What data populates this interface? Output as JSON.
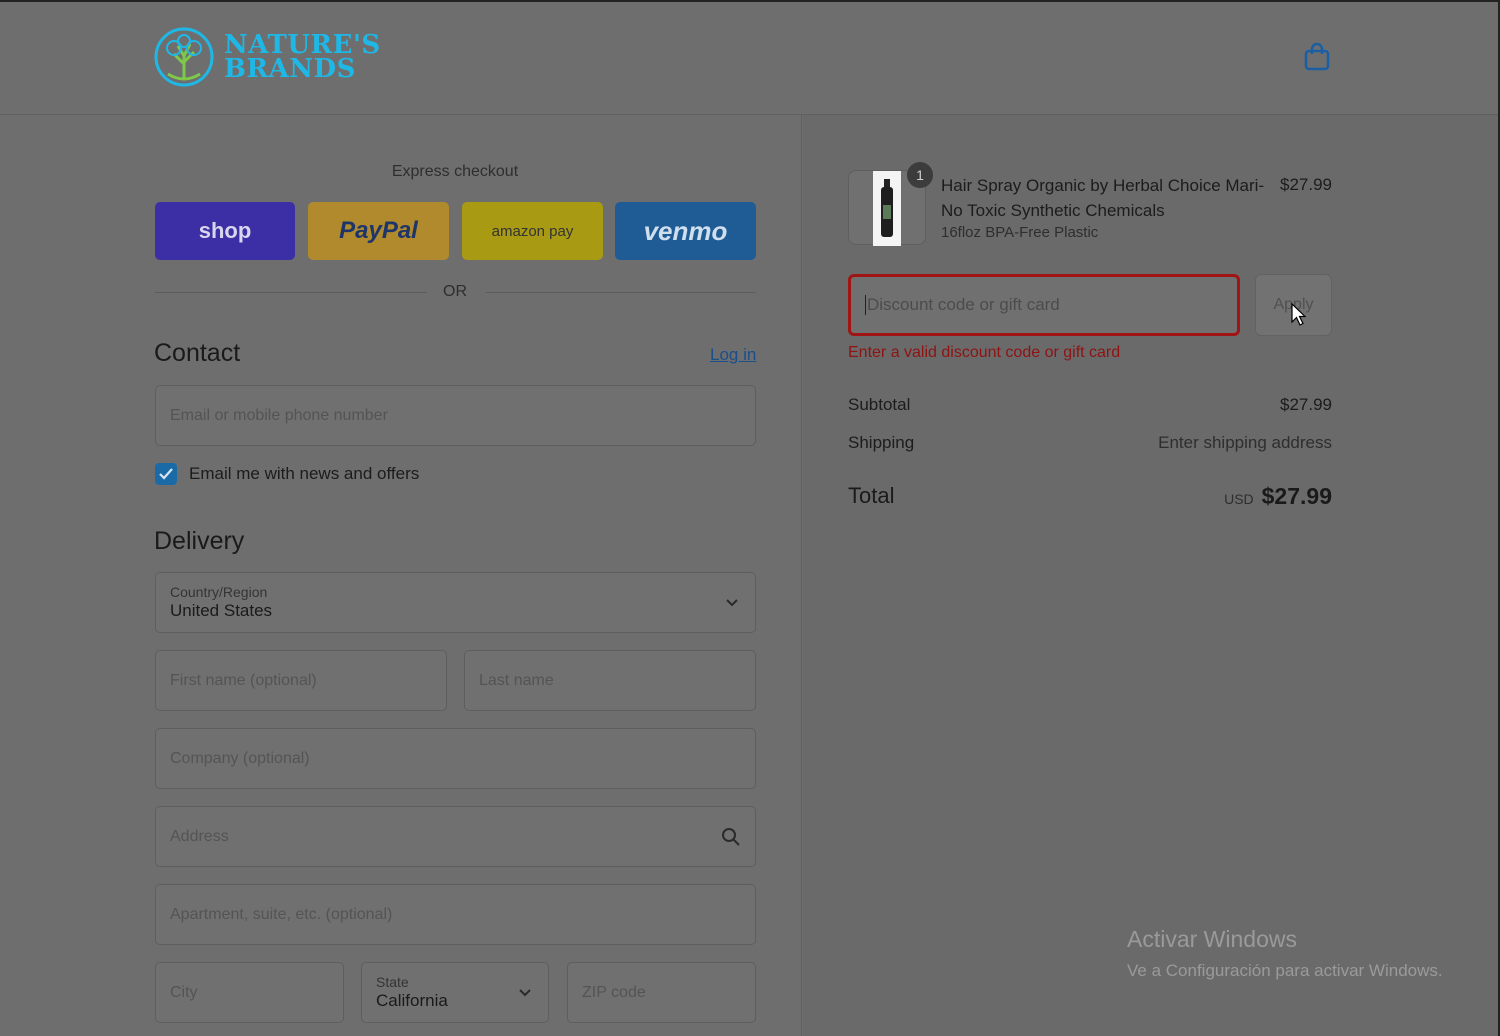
{
  "brand": {
    "name_line1": "NATURE'S",
    "name_line2": "BRANDS"
  },
  "header": {
    "cart_icon": "shopping-bag-icon"
  },
  "express": {
    "title": "Express checkout",
    "buttons": {
      "shop": "shop",
      "paypal": "PayPal",
      "amazon": "amazon pay",
      "venmo": "venmo"
    },
    "or": "OR"
  },
  "contact": {
    "heading": "Contact",
    "login": "Log in",
    "email_placeholder": "Email or mobile phone number",
    "newsletter_label": "Email me with news and offers",
    "newsletter_checked": true
  },
  "delivery": {
    "heading": "Delivery",
    "country_label": "Country/Region",
    "country_value": "United States",
    "first_name_placeholder": "First name (optional)",
    "last_name_placeholder": "Last name",
    "company_placeholder": "Company (optional)",
    "address_placeholder": "Address",
    "apartment_placeholder": "Apartment, suite, etc. (optional)",
    "city_placeholder": "City",
    "state_label": "State",
    "state_value": "California",
    "zip_placeholder": "ZIP code"
  },
  "order": {
    "item": {
      "quantity": "1",
      "title": "Hair Spray Organic by Herbal Choice Mari- No Toxic Synthetic Chemicals",
      "variant": "16floz BPA-Free Plastic",
      "price": "$27.99"
    },
    "discount_placeholder": "Discount code or gift card",
    "apply_label": "Apply",
    "discount_error": "Enter a valid discount code or gift card",
    "subtotal_label": "Subtotal",
    "subtotal_value": "$27.99",
    "shipping_label": "Shipping",
    "shipping_value": "Enter shipping address",
    "total_label": "Total",
    "total_currency": "USD",
    "total_value": "$27.99"
  },
  "watermark": {
    "line1": "Activar Windows",
    "line2": "Ve a Configuración para activar Windows."
  },
  "colors": {
    "overlay": "#6e6e6e",
    "error": "#a11414",
    "link": "#1a4f8b",
    "checkbox": "#1a6aa8",
    "brand": "#1fb8e6"
  }
}
